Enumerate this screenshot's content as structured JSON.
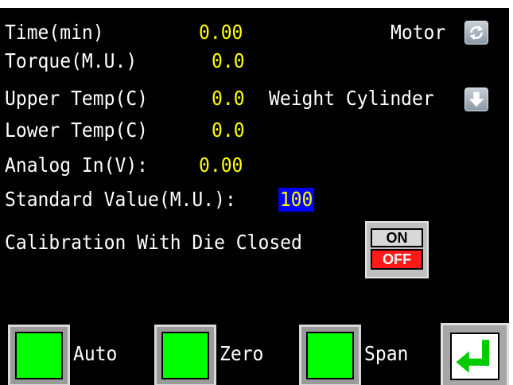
{
  "readouts": {
    "time": {
      "label": "Time(min)",
      "value": "0.00"
    },
    "torque": {
      "label": "Torque(M.U.)",
      "value": "0.0"
    },
    "upper_temp": {
      "label": "Upper Temp(C)",
      "value": "0.0"
    },
    "lower_temp": {
      "label": "Lower Temp(C)",
      "value": "0.0"
    },
    "analog_in": {
      "label": "Analog In(V):",
      "value": "0.00"
    },
    "standard_value": {
      "label": "Standard Value(M.U.):",
      "value": "100"
    }
  },
  "controls": {
    "motor_label": "Motor",
    "motor_icon": "refresh-icon",
    "weight_cylinder_label": "Weight Cylinder",
    "weight_cylinder_icon": "arrow-down-icon",
    "calibration_label": "Calibration With Die Closed",
    "toggle": {
      "on_label": "ON",
      "off_label": "OFF",
      "state": "OFF"
    }
  },
  "buttons": {
    "auto": "Auto",
    "zero": "Zero",
    "span": "Span",
    "enter_icon": "enter-return-icon"
  },
  "colors": {
    "background": "#000000",
    "label_text": "#ffffff",
    "value_text": "#ffff00",
    "selected_value_bg": "#0000ff",
    "button_green": "#00ff00",
    "off_red": "#ff1a1a"
  }
}
